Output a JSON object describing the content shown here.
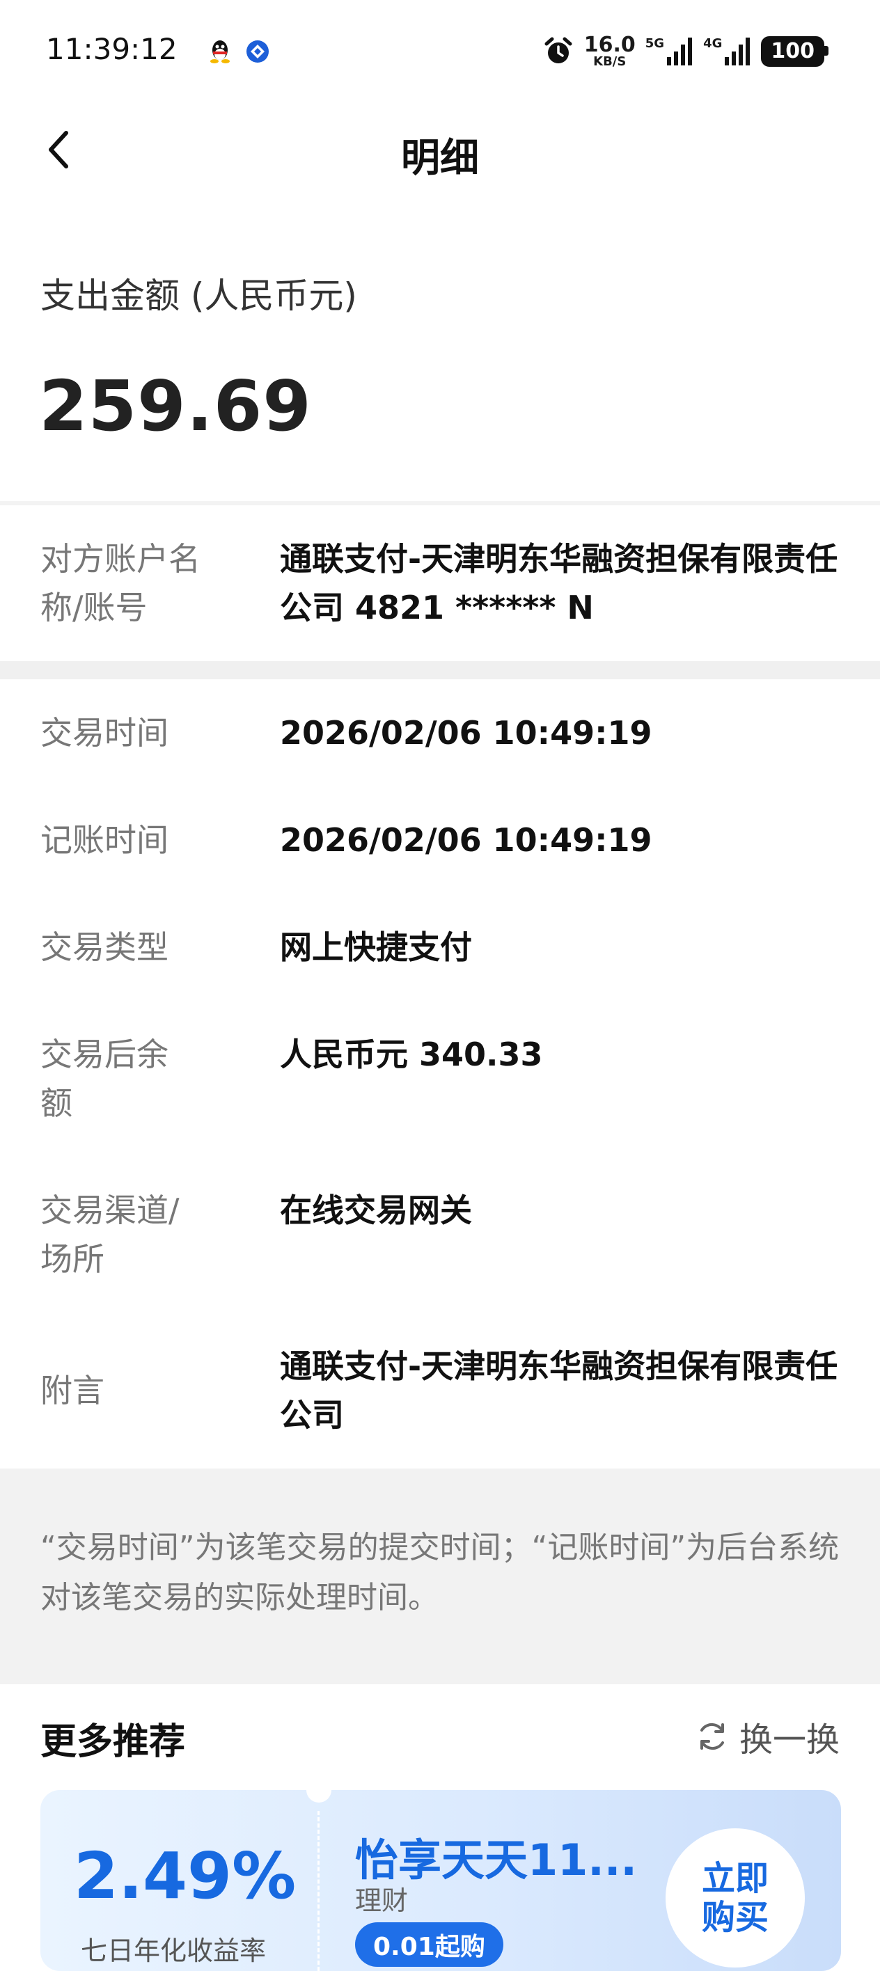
{
  "status_bar": {
    "time": "11:39:12",
    "speed_value": "16.0",
    "speed_unit": "KB/S",
    "net1_tag": "5G",
    "net2_tag": "4G",
    "battery": "100",
    "apps": [
      "qq-icon",
      "bank-app-icon"
    ]
  },
  "nav": {
    "title": "明细"
  },
  "amount": {
    "label": "支出金额 (人民币元)",
    "value": "259.69"
  },
  "details": [
    {
      "label": "对方账户名称/账号",
      "value": "通联支付-天津明东华融资担保有限责任公司 4821 ****** N"
    },
    {
      "label": "交易时间",
      "value": "2026/02/06 10:49:19"
    },
    {
      "label": "记账时间",
      "value": "2026/02/06 10:49:19"
    },
    {
      "label": "交易类型",
      "value": "网上快捷支付"
    },
    {
      "label": "交易后余额",
      "value": "人民币元 340.33"
    },
    {
      "label": "交易渠道/场所",
      "value": "在线交易网关"
    },
    {
      "label": "附言",
      "value": "通联支付-天津明东华融资担保有限责任公司"
    }
  ],
  "note": "“交易时间”为该笔交易的提交时间；“记账时间”为后台系统对该笔交易的实际处理时间。",
  "recommend": {
    "title": "更多推荐",
    "refresh_label": "换一换",
    "card": {
      "rate": "2.49%",
      "rate_sub": "七日年化收益率",
      "name": "怡享天天11...",
      "type": "理财",
      "tag": "0.01起购",
      "buy_label": "立即购买"
    }
  },
  "colors": {
    "accent": "#1769e0",
    "background": "#ffffff",
    "note_background": "#f2f2f2"
  }
}
